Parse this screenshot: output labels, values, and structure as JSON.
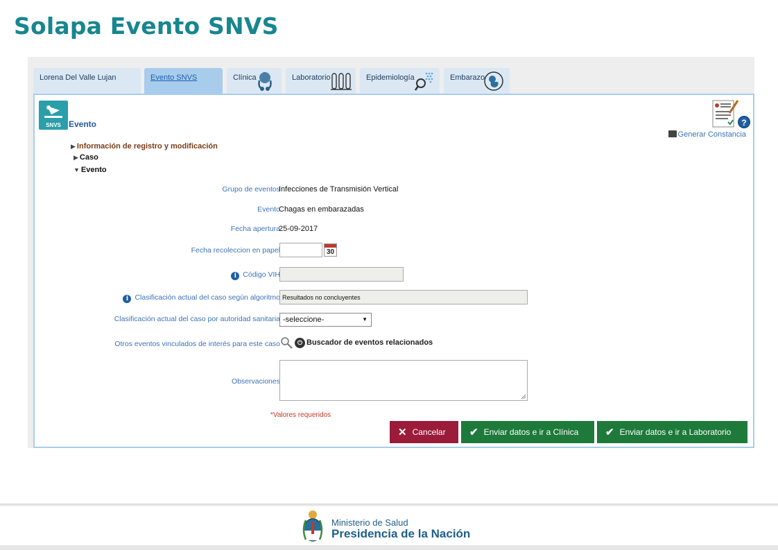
{
  "slide": {
    "title": "Solapa Evento SNVS"
  },
  "tabs": [
    {
      "label": "Lorena Del Valle Lujan",
      "active": false,
      "icon": ""
    },
    {
      "label": "Evento SNVS",
      "active": true,
      "icon": ""
    },
    {
      "label": "Clínica",
      "active": false,
      "icon": "stethoscope-icon"
    },
    {
      "label": "Laboratorio",
      "active": false,
      "icon": "test-tubes-icon"
    },
    {
      "label": "Epidemiología",
      "active": false,
      "icon": "magnifier-icon"
    },
    {
      "label": "Embarazo",
      "active": false,
      "icon": "fetus-icon"
    }
  ],
  "panel": {
    "logo_text": "SNVS",
    "title": "Evento",
    "help": "?",
    "generar_constancia": "Generar Constancia"
  },
  "tree": {
    "info": "Información de registro y modificación",
    "caso": "Caso",
    "evento": "Evento"
  },
  "form": {
    "grupo_label": "Grupo de eventos",
    "grupo_value": "Infecciones de Transmisión Vertical",
    "evento_label": "Evento",
    "evento_value": "Chagas en embarazadas",
    "fecha_apertura_label": "Fecha apertura",
    "fecha_apertura_value": "25-09-2017",
    "fecha_recoleccion_label": "Fecha recoleccion en papel",
    "calendar_day": "30",
    "codigo_vih_label": "Código VIH",
    "clasif_algoritmo_label": "Clasificación actual del caso según algoritmo",
    "clasif_algoritmo_value": "Resultados no concluyentes",
    "clasif_autoridad_label": "Clasificación actual del caso por autoridad sanitaria",
    "clasif_autoridad_selected": "-seleccione-",
    "otros_eventos_label": "Otros eventos vinculados de interés para este caso",
    "buscador_label": "Buscador de eventos relacionados",
    "observaciones_label": "Observaciones",
    "requeridos": "*Valores requeridos"
  },
  "buttons": {
    "cancel": "Cancelar",
    "clinica": "Enviar datos e ir a Clínica",
    "laboratorio": "Enviar datos e ir a Laboratorio"
  },
  "footer": {
    "ministerio": "Ministerio de Salud",
    "presidencia": "Presidencia de la Nación"
  },
  "colors": {
    "title_teal": "#17868f",
    "label_blue": "#3c73b8",
    "cancel_red": "#9b1b3b",
    "confirm_green": "#1d7a3a",
    "tab_active": "#a8cdec"
  }
}
